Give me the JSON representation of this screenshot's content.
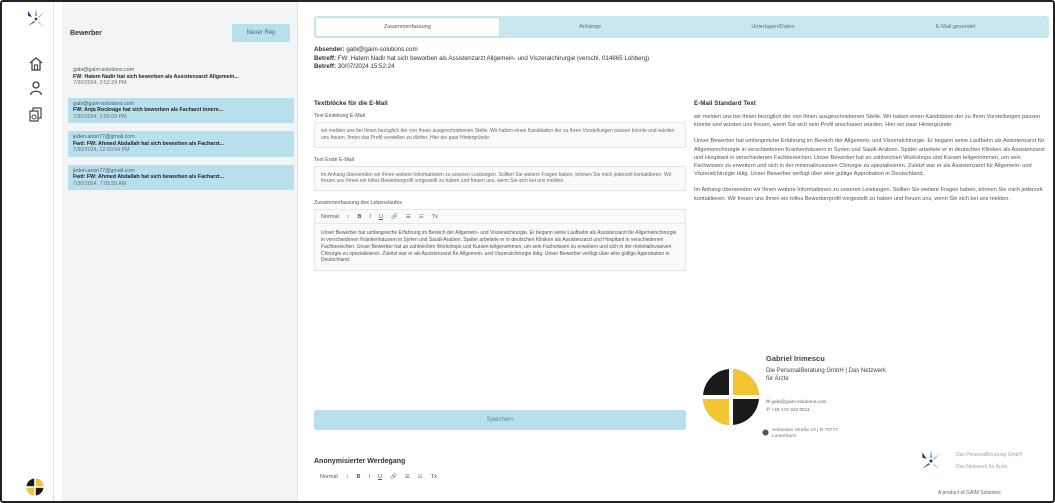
{
  "sidebar": {
    "title": "Bewerber",
    "button_label": "Neuer Rep",
    "items": [
      {
        "from": "gabi@gaim-solutions.com",
        "subject": "FW: Hatem Nadir hat sich beworben als Assistenzarzt Allgemein...",
        "date": "7/30/2024, 3:52:24 PM",
        "selected": false
      },
      {
        "from": "gabi@gaim-solutions.com",
        "subject": "FW: Anja Rockrage hat sich beworben als Facharzt innere...",
        "date": "7/30/2024, 3:55:09 PM",
        "selected": true
      },
      {
        "from": "jeden.anon77@gmail.com",
        "subject": "Fwd: FW: Ahmed Abdallah hat sich beworben als Facharzt...",
        "date": "7/30/2024, 12:00:54 PM",
        "selected": true
      },
      {
        "from": "jeden.anon77@gmail.com",
        "subject": "Fwd: FW: Ahmed Abdallah hat sich beworben als Facharzt...",
        "date": "7/30/2024, 7:05:55 AM",
        "selected": true
      }
    ]
  },
  "tabs": [
    "Zusammenfassung",
    "Anhänge",
    "Unterlagen/Daten",
    "E-Mail gesendet"
  ],
  "header": {
    "sender_label": "Absender:",
    "sender": "gabi@gaim-solutions.com",
    "subject_label": "Betreff:",
    "subject": "FW: Hatem Nadir hat sich beworben als Assistenzarzt Allgemein- und Viszeralchirurgie (verschl. 014865 Lohberg)",
    "date_label": "Betreff:",
    "date": "30/07/2024 15:52:24"
  },
  "left": {
    "heading": "Textblöcke für die E-Mail",
    "intro_label": "Text Einleitung E-Mail",
    "intro_text": "wir melden uns bei Ihnen bezüglich der von Ihnen ausgeschriebenen Stelle. Wir haben einen Kandidaten der zu Ihren Vorstellungen passen könnte und würden uns freuen, Ihnen das Profil vorstellen zu dürfen. Hier ein paar Hintergründe:",
    "outro_label": "Text Ende E-Mail",
    "outro_text": "Im Anhang übersenden wir Ihnen weitere Informationen zu unseren Leistungen. Sollten Sie weitere Fragen haben, können Sie mich jederzeit kontaktieren. Wir freuen uns Ihnen ein tolles Bewerberprofil vorgestellt zu haben und freuen uns, wenn Sie sich bei uns melden.",
    "summary_label": "Zusammenfassung des Lebenslaufes",
    "toolbar": [
      "Normal",
      "↕",
      "B",
      "I",
      "U",
      "🔗",
      "☰",
      "☷",
      "Tx"
    ],
    "summary_text": "Unser Bewerber hat umfangreiche Erfahrung im Bereich der Allgemein- und Viszeralchirurgie. Er begann seine Laufbahn als Assistenzarzt für Allgemeinchirurgie in verschiedenen Krankenhäusern in Syrien und Saudi-Arabien. Später arbeitete er in deutschen Kliniken als Assistenzarzt und Hospitant in verschiedenen Fachbereichen. Unser Bewerber hat an zahlreichen Workshops und Kursen teilgenommen, um sein Fachwissen zu erweitern und sich in der minimalinvasiven Chirurgie zu spezialisieren. Zuletzt war er als Assistenzarzt für Allgemein- und Viszeralchirurgie tätig. Unser Bewerber verfügt über eine gültige Approbation in Deutschland.",
    "save_label": "Speichern",
    "anon_title": "Anonymisierter Werdegang",
    "toolbar2": [
      "Normal",
      "↕",
      "B",
      "I",
      "U",
      "🔗",
      "☰",
      "☷",
      "Tx"
    ]
  },
  "right": {
    "heading": "E-Mail Standard Text",
    "p1": "wir melden uns bei Ihnen bezüglich der von Ihnen ausgeschriebenen Stelle. Wir haben einen Kandidaten der zu Ihren Vorstellungen passen könnte und würden uns freuen, wenn Sie sich sein Profil anschauen würden. Hier ein paar Hintergründe:",
    "p2": "Unser Bewerber hat umfangreiche Erfahrung im Bereich der Allgemein- und Viszeralchirurgie. Er begann seine Laufbahn als Assistenzarzt für Allgemeinchirurgie in verschiedenen Krankenhäusern in Syrien und Saudi-Arabien. Später arbeitete er in deutschen Kliniken als Assistenzarzt und Hospitant in verschiedenen Fachbereichen. Unser Bewerber hat an zahlreichen Workshops und Kursen teilgenommen, um sein Fachwissen zu erweitern und sich in der minimalinvasiven Chirurgie zu spezialisieren. Zuletzt war er als Assistenzarzt für Allgemein- und Viszeralchirurgie tätig. Unser Bewerber verfügt über eine gültige Approbation in Deutschland.",
    "p3": "Im Anhang übersenden wir Ihnen weitere Informationen zu unseren Leistungen. Sollten Sie weitere Fragen haben, können Sie mich jederzeit kontaktieren. Wir freuen uns Ihnen ein tolles Bewerberprofil vorgestellt zu haben und freuen uns, wenn Sie sich bei uns melden."
  },
  "signature": {
    "name": "Gabriel Irimescu",
    "company": "Die PersonalBeratung GmbH | Das Netzwerk für Ärzte",
    "email": "gabi@gaim-solutions.com",
    "phone": "+49 172 322 0511",
    "address": "Sebastian Straße 10 | D 79777 Lauterbach"
  },
  "brand": {
    "line1": "Das PersonalBeratung GmbH",
    "line2": "Das Netzwerk für Ärzte",
    "footer": "A product of GAIM Solutions"
  },
  "colors": {
    "accent": "#b7e0ec",
    "tabs_bg": "#c8e7f1",
    "logo_yellow": "#f4c431",
    "logo_black": "#1a1a1a"
  }
}
